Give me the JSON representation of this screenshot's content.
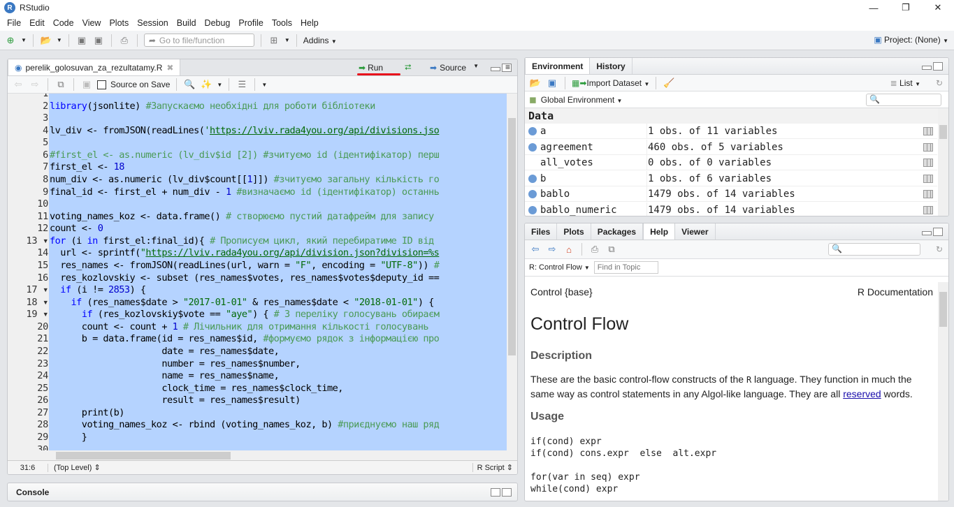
{
  "window": {
    "title": "RStudio",
    "minimize": "—",
    "maximize": "❐",
    "close": "✕"
  },
  "menu": [
    "File",
    "Edit",
    "Code",
    "View",
    "Plots",
    "Session",
    "Build",
    "Debug",
    "Profile",
    "Tools",
    "Help"
  ],
  "toolbar": {
    "goto_placeholder": "Go to file/function",
    "addins": "Addins",
    "project": "Project: (None)"
  },
  "editor": {
    "tab": "perelik_golosuvan_za_rezultatamy.R",
    "source_on_save": "Source on Save",
    "run": "Run",
    "source": "Source",
    "accent": "#e8121c",
    "lines": [
      "",
      "library(jsonlite) #Запускаємо необхідні для роботи бібліотеки",
      "",
      "lv_div <- fromJSON(readLines('https://lviv.rada4you.org/api/divisions.jso",
      "",
      "#first_el <- as.numeric (lv_div$id [2]) #зчитуємо id (ідентифікатор) перш",
      "first_el <- 18",
      "num_div <- as.numeric (lv_div$count[[1]]) #зчитуємо загальну кількість го",
      "final_id <- first_el + num_div - 1 #визначаємо id (ідентифікатор) останнь",
      "",
      "voting_names_koz <- data.frame() # створюємо пустий датафрейм для запису",
      "count <- 0",
      "for (i in first_el:final_id){ # Прописуєм цикл, який перебиратиме ID від",
      "  url <- sprintf(\"https://lviv.rada4you.org/api/division.json?division=%s",
      "  res_names <- fromJSON(readLines(url, warn = \"F\", encoding = \"UTF-8\")) #",
      "  res_kozlovskiy <- subset (res_names$votes, res_names$votes$deputy_id ==",
      "  if (i != 2853) {",
      "    if (res_names$date > \"2017-01-01\" & res_names$date < \"2018-01-01\") {",
      "      if (res_kozlovskiy$vote == \"aye\") { # З переліку голосувань обираєм",
      "      count <- count + 1 # Лічильник для отримання кількості голосувань",
      "      b = data.frame(id = res_names$id, #формуємо рядок з інформацією про",
      "                     date = res_names$date,",
      "                     number = res_names$number,",
      "                     name = res_names$name,",
      "                     clock_time = res_names$clock_time,",
      "                     result = res_names$result)",
      "      print(b)",
      "      voting_names_koz <- rbind (voting_names_koz, b) #приєднуємо наш ряд",
      "      }",
      ""
    ],
    "fold_lines": [
      13,
      17,
      18,
      19
    ],
    "cursor": "31:6",
    "scope": "(Top Level)",
    "filetype": "R Script"
  },
  "console": {
    "title": "Console"
  },
  "env": {
    "tabs": [
      "Environment",
      "History"
    ],
    "import": "Import Dataset",
    "view": "List",
    "scope": "Global Environment",
    "section": "Data",
    "rows": [
      {
        "name": "a",
        "value": "1 obs. of 11 variables",
        "expandable": true
      },
      {
        "name": "agreement",
        "value": "460 obs. of 5 variables",
        "expandable": true
      },
      {
        "name": "all_votes",
        "value": "0 obs. of 0 variables",
        "expandable": false
      },
      {
        "name": "b",
        "value": "1 obs. of 6 variables",
        "expandable": true
      },
      {
        "name": "bablo",
        "value": "1479 obs. of 14 variables",
        "expandable": true
      },
      {
        "name": "bablo_numeric",
        "value": "1479 obs. of 14 variables",
        "expandable": true
      }
    ]
  },
  "files": {
    "tabs": [
      "Files",
      "Plots",
      "Packages",
      "Help",
      "Viewer"
    ],
    "active": "Help",
    "topic": "R: Control Flow",
    "find_placeholder": "Find in Topic",
    "help": {
      "left": "Control {base}",
      "right": "R Documentation",
      "title": "Control Flow",
      "desc_h": "Description",
      "desc_1": "These are the basic control-flow constructs of the ",
      "desc_r": "R",
      "desc_2": " language. They function in much the same way as control statements in any Algol-like language. They are all ",
      "desc_link": "reserved",
      "desc_3": " words.",
      "usage_h": "Usage",
      "usage": [
        "if(cond) expr",
        "if(cond) cons.expr  else  alt.expr",
        "",
        "for(var in seq) expr",
        "while(cond) expr"
      ]
    }
  }
}
